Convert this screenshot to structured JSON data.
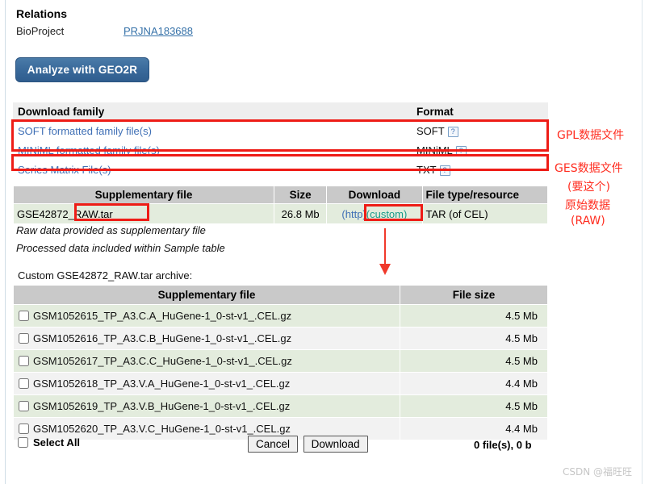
{
  "relations": {
    "title": "Relations",
    "key": "BioProject",
    "value": "PRJNA183688"
  },
  "geo2r": {
    "label": "Analyze with GEO2R"
  },
  "download_family": {
    "headers": [
      "Download family",
      "Format"
    ],
    "rows": [
      {
        "name": "SOFT formatted family file(s)",
        "format": "SOFT",
        "help": "?"
      },
      {
        "name": "MINiML formatted family file(s)",
        "format": "MINiML",
        "help": "?"
      },
      {
        "name": "Series Matrix File(s)",
        "format": "TXT",
        "help": "?"
      }
    ]
  },
  "annotations": {
    "gpl": "GPL数据文件",
    "ges": "GES数据文件",
    "need_this": "(要这个)",
    "raw_line1": "原始数据",
    "raw_line2": "(RAW)"
  },
  "supplementary": {
    "headers": [
      "Supplementary file",
      "Size",
      "Download",
      "File type/resource"
    ],
    "row": {
      "file": "GSE42872_RAW.tar",
      "size": "26.8 Mb",
      "http": "(http)",
      "custom": "(custom)",
      "type": "TAR (of CEL)"
    },
    "notes": [
      "Raw data provided as supplementary file",
      "Processed data included within Sample table"
    ]
  },
  "archive": {
    "label": "Custom GSE42872_RAW.tar archive:",
    "headers": [
      "Supplementary file",
      "File size"
    ],
    "files": [
      {
        "name": "GSM1052615_TP_A3.C.A_HuGene-1_0-st-v1_.CEL.gz",
        "size": "4.5 Mb"
      },
      {
        "name": "GSM1052616_TP_A3.C.B_HuGene-1_0-st-v1_.CEL.gz",
        "size": "4.5 Mb"
      },
      {
        "name": "GSM1052617_TP_A3.C.C_HuGene-1_0-st-v1_.CEL.gz",
        "size": "4.5 Mb"
      },
      {
        "name": "GSM1052618_TP_A3.V.A_HuGene-1_0-st-v1_.CEL.gz",
        "size": "4.4 Mb"
      },
      {
        "name": "GSM1052619_TP_A3.V.B_HuGene-1_0-st-v1_.CEL.gz",
        "size": "4.5 Mb"
      },
      {
        "name": "GSM1052620_TP_A3.V.C_HuGene-1_0-st-v1_.CEL.gz",
        "size": "4.4 Mb"
      }
    ]
  },
  "footer": {
    "select_all": "Select All",
    "cancel": "Cancel",
    "download": "Download",
    "file_count": "0 file(s), 0 b"
  },
  "watermark": "CSDN @福旺旺",
  "colors": {
    "link_blue": "#3f6fb5",
    "link_teal": "#1a9b8a",
    "highlight_red": "#ee1c16",
    "annotation_red": "#ff2d20",
    "button_blue": "#3b6b9c",
    "row_green": "#e3ecdd",
    "header_gray": "#c9c9c9"
  }
}
